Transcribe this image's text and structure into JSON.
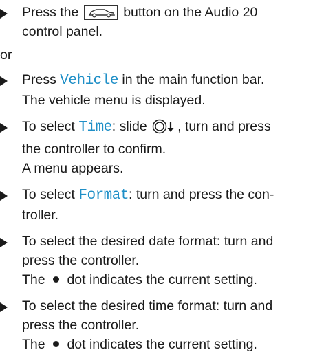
{
  "steps": [
    {
      "lines": [
        {
          "pre": "Press the ",
          "icon": "car-button-icon",
          "post": " button on the Audio 20"
        },
        {
          "text": "control panel."
        }
      ]
    }
  ],
  "or_label": "or",
  "steps2": [
    {
      "line1_pre": "Press ",
      "line1_kw": "Vehicle",
      "line1_post": " in the main function bar.",
      "result": "The vehicle menu is displayed."
    },
    {
      "line1_pre": "To select ",
      "line1_kw": "Time",
      "line1_post": ": slide ",
      "line1_icon": "controller-slide-down-icon",
      "line1_post2": ", turn and press",
      "line2": "the controller to confirm.",
      "result": "A menu appears."
    },
    {
      "line1_pre": "To select ",
      "line1_kw": "Format",
      "line1_post": ": turn and press the con-",
      "line2": "troller."
    },
    {
      "line1": "To select the desired date format: turn and",
      "line2": "press the controller.",
      "result_pre": "The ",
      "result_post": " dot indicates the current setting."
    },
    {
      "line1": "To select the desired time format: turn and",
      "line2": "press the controller.",
      "result_pre": "The ",
      "result_post": " dot indicates the current setting."
    }
  ],
  "colors": {
    "keyword": "#1f8fc7",
    "text": "#1a1a1a"
  }
}
